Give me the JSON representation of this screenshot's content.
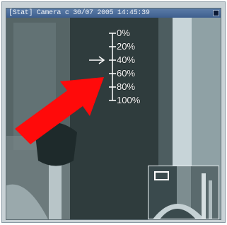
{
  "window": {
    "title": "[Stat] Camera c 30/07 2005 14:45:39"
  },
  "zoom_scale": {
    "ticks": [
      "0%",
      "20%",
      "40%",
      "60%",
      "80%",
      "100%"
    ],
    "current_level_percent": 40
  },
  "icons": {
    "level_pointer": "right-arrow-icon",
    "callout": "red-arrow-icon"
  },
  "colors": {
    "callout_arrow": "#ff0a0a",
    "scale": "#ffffff",
    "titlebar": "#3e5f8e"
  }
}
